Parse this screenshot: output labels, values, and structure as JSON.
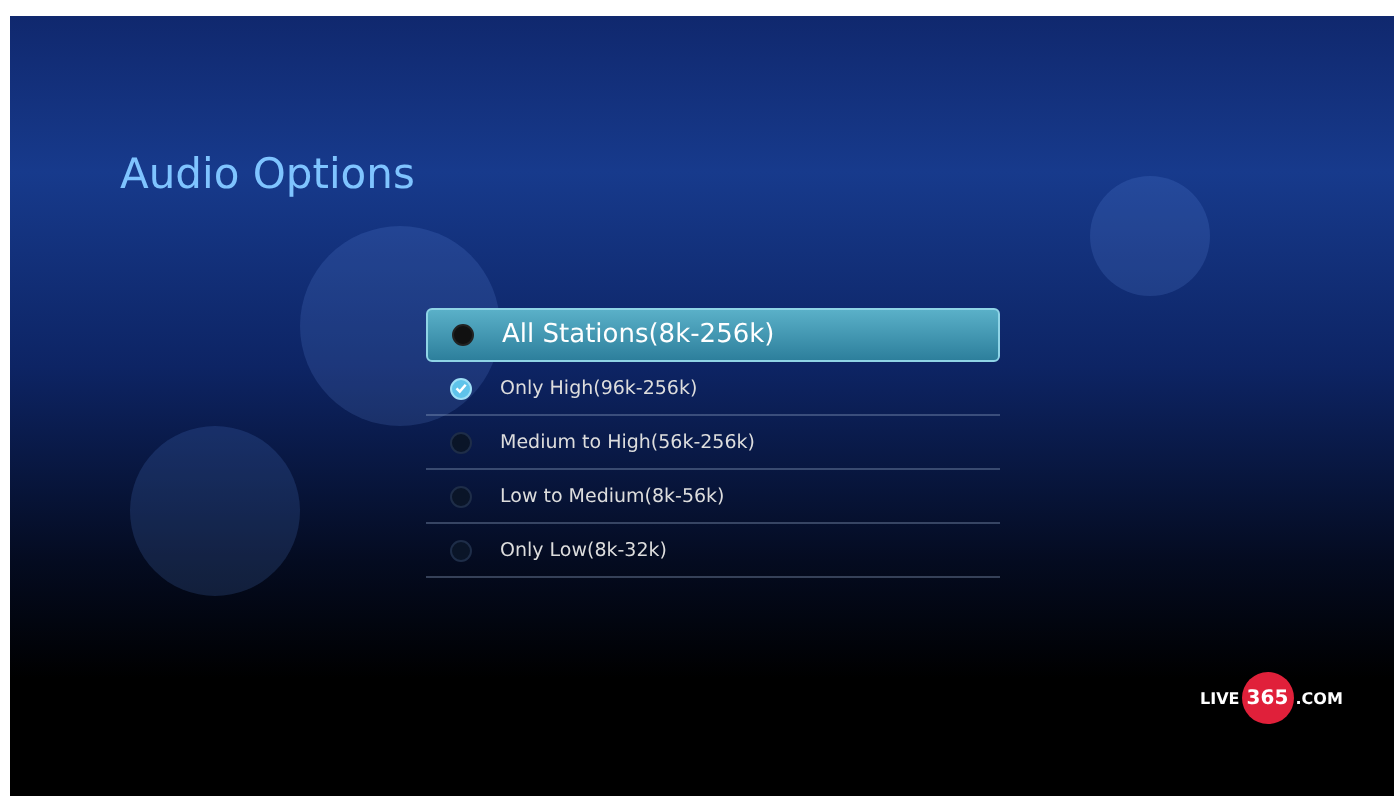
{
  "title": "Audio Options",
  "options": [
    {
      "label": "All Stations(8k-256k)",
      "selected": true,
      "checked": false
    },
    {
      "label": "Only High(96k-256k)",
      "selected": false,
      "checked": true
    },
    {
      "label": "Medium to High(56k-256k)",
      "selected": false,
      "checked": false
    },
    {
      "label": "Low to Medium(8k-56k)",
      "selected": false,
      "checked": false
    },
    {
      "label": "Only Low(8k-32k)",
      "selected": false,
      "checked": false
    }
  ],
  "logo": {
    "prefix": "LIVE",
    "number": "365",
    "suffix": ".COM"
  }
}
